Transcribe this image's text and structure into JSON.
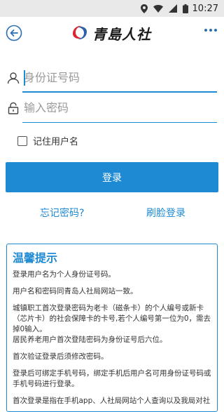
{
  "statusbar": {
    "time": "10:27",
    "icons": [
      "location-icon",
      "wifi-icon",
      "signal-icon",
      "battery-icon"
    ]
  },
  "appbar": {
    "logo_text": "青島人社",
    "back_icon": "back-arrow-icon",
    "more_icon": "more-dots-icon"
  },
  "form": {
    "id_placeholder": "身份证号码",
    "password_placeholder": "输入密码",
    "remember_label": "记住用户名",
    "login_label": "登录",
    "forgot_label": "忘记密码?",
    "face_login_label": "刷脸登录"
  },
  "notice": {
    "title": "温馨提示",
    "paragraphs": [
      "登录用户名为个人身份证号码。",
      "用户名和密码同青岛人社局网站一致。",
      "城镇职工首次登录密码为老卡（磁条卡）的个人编号或新卡（芯片卡）的社会保障卡的卡号,若个人编号第一位为0，需去掉0输入。",
      "居民养老用户首次登陆密码为身份证号后六位。",
      "首次验证登录后须修改密码。",
      "登录后可绑定手机号码，绑定手机后用户名可用身份证号码或手机号码进行登录。",
      "首次登录是指在手机app、人社局网站个人查询以及我局对社"
    ]
  },
  "colors": {
    "accent": "#1e8ad3",
    "statusbar_bg": "#e9e9e9"
  }
}
